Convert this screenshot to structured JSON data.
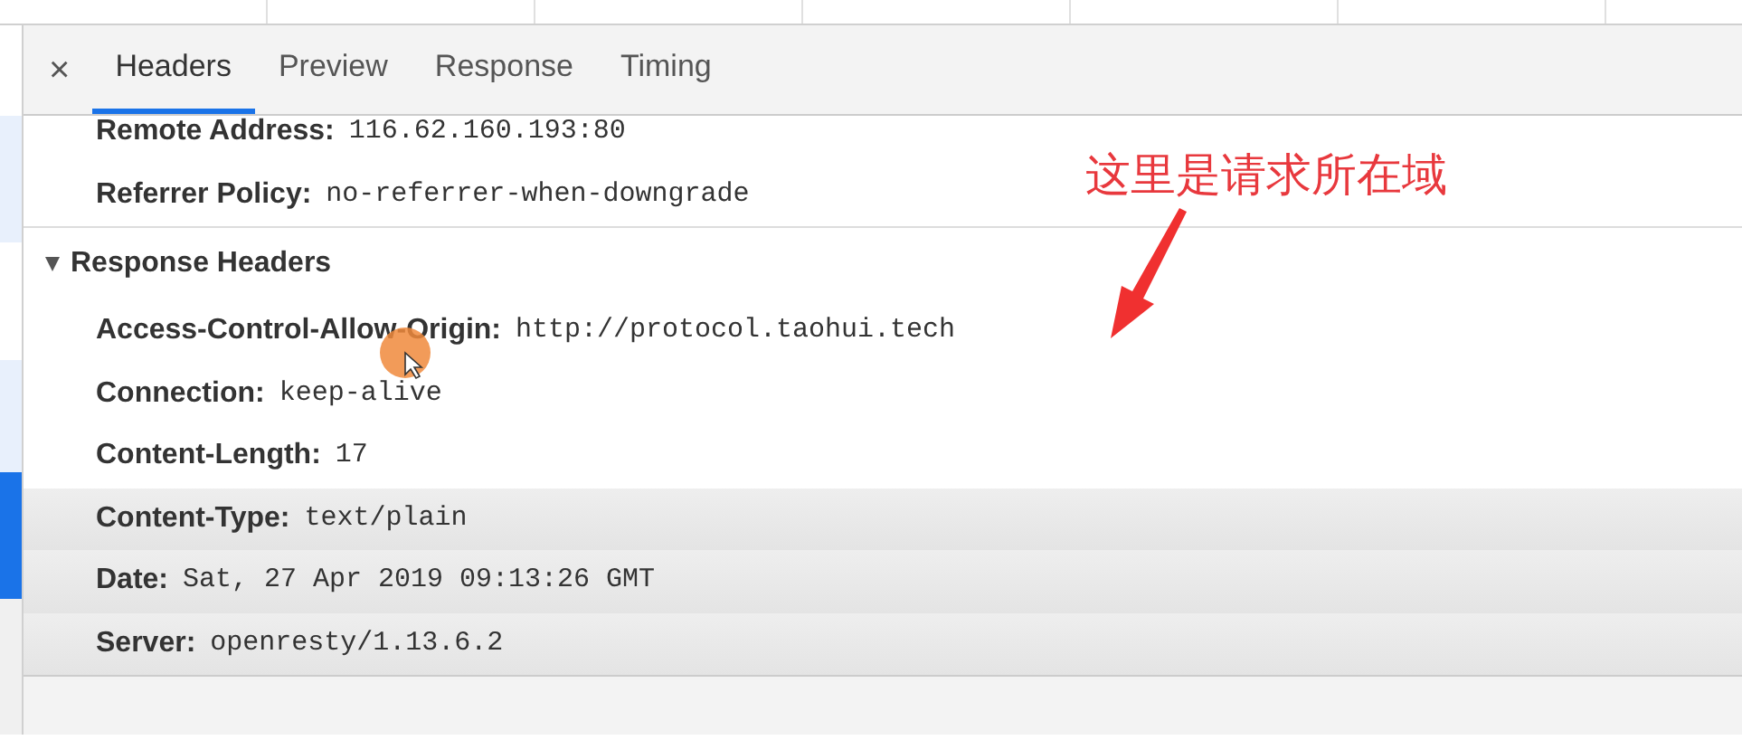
{
  "close_label": "×",
  "tabs": [
    {
      "label": "Headers",
      "selected": true
    },
    {
      "label": "Preview",
      "selected": false
    },
    {
      "label": "Response",
      "selected": false
    },
    {
      "label": "Timing",
      "selected": false
    }
  ],
  "general_rows": [
    {
      "name": "Remote Address:",
      "value": "116.62.160.193:80"
    },
    {
      "name": "Referrer Policy:",
      "value": "no-referrer-when-downgrade"
    }
  ],
  "response_headers": {
    "title": "Response Headers",
    "expanded": true,
    "rows": [
      {
        "name": "Access-Control-Allow-Origin:",
        "value": "http://protocol.taohui.tech"
      },
      {
        "name": "Connection:",
        "value": "keep-alive"
      },
      {
        "name": "Content-Length:",
        "value": "17"
      },
      {
        "name": "Content-Type:",
        "value": "text/plain"
      },
      {
        "name": "Date:",
        "value": "Sat, 27 Apr 2019 09:13:26 GMT"
      },
      {
        "name": "Server:",
        "value": "openresty/1.13.6.2"
      }
    ]
  },
  "annotation": {
    "text": "这里是请求所在域"
  }
}
